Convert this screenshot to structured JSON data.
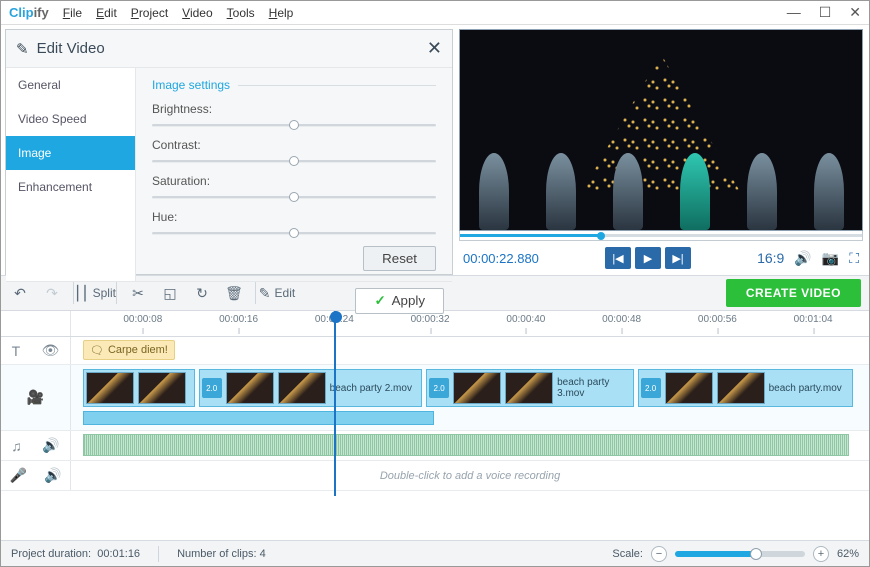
{
  "app": {
    "logo1": "Clip",
    "logo2": "ify"
  },
  "menu": {
    "file": "File",
    "edit": "Edit",
    "project": "Project",
    "video": "Video",
    "tools": "Tools",
    "help": "Help"
  },
  "panel": {
    "title": "Edit Video",
    "tabs": {
      "general": "General",
      "speed": "Video Speed",
      "image": "Image",
      "enhance": "Enhancement"
    },
    "legend": "Image settings",
    "brightness": "Brightness:",
    "contrast": "Contrast:",
    "saturation": "Saturation:",
    "hue": "Hue:",
    "reset": "Reset",
    "apply": "Apply"
  },
  "preview": {
    "timecode": "00:00:22.880",
    "ratio": "16:9"
  },
  "toolbar": {
    "split": "Split",
    "edit": "Edit",
    "create": "CREATE VIDEO"
  },
  "ruler": [
    "00:00:08",
    "00:00:16",
    "00:00:24",
    "00:00:32",
    "00:00:40",
    "00:00:48",
    "00:00:56",
    "00:01:04"
  ],
  "textchip": "Carpe diem!",
  "clips": {
    "c2": "beach party 2.mov",
    "c3": "beach party 3.mov",
    "c4": "beach party.mov",
    "tspeed": "2.0"
  },
  "voice_hint": "Double-click to add a voice recording",
  "status": {
    "duration_lbl": "Project duration:",
    "duration": "00:01:16",
    "clips_lbl": "Number of clips:",
    "clips": "4",
    "scale_lbl": "Scale:",
    "scale_pct": "62%"
  }
}
